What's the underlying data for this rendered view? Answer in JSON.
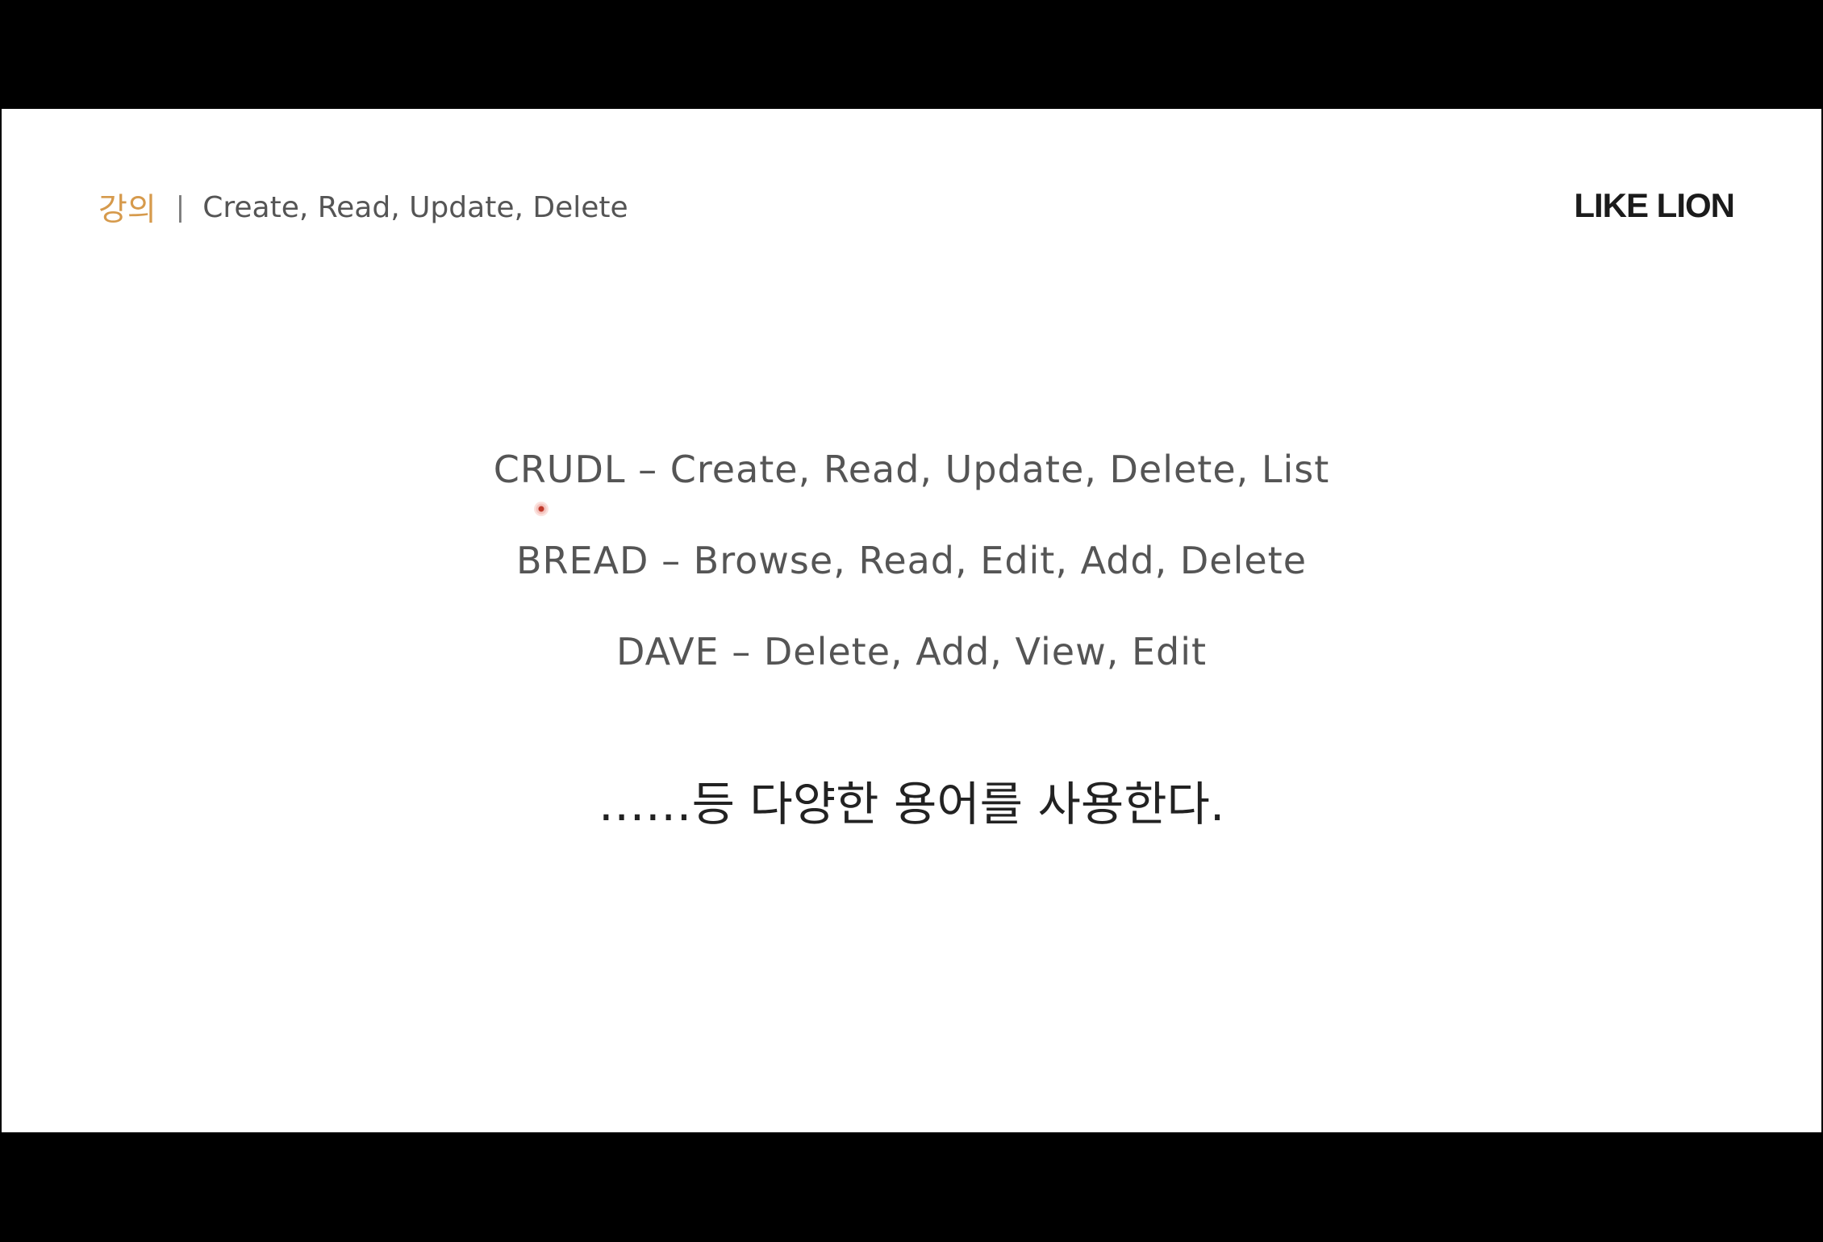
{
  "slide": {
    "section_tag": "강의",
    "separator": "|",
    "section_title": "Create, Read, Update, Delete",
    "logo_text": "LIKE LION",
    "lines": [
      "CRUDL – Create, Read, Update, Delete, List",
      "BREAD – Browse, Read, Edit, Add, Delete",
      "DAVE – Delete, Add, View, Edit"
    ],
    "summary": "……등 다양한 용어를 사용한다."
  },
  "colors": {
    "accent": "#d69a4c",
    "text": "#555555",
    "summary_text": "#222222",
    "background": "#ffffff",
    "letterbox": "#000000"
  },
  "icons": {
    "cursor": "mouse-pointer-dot"
  }
}
